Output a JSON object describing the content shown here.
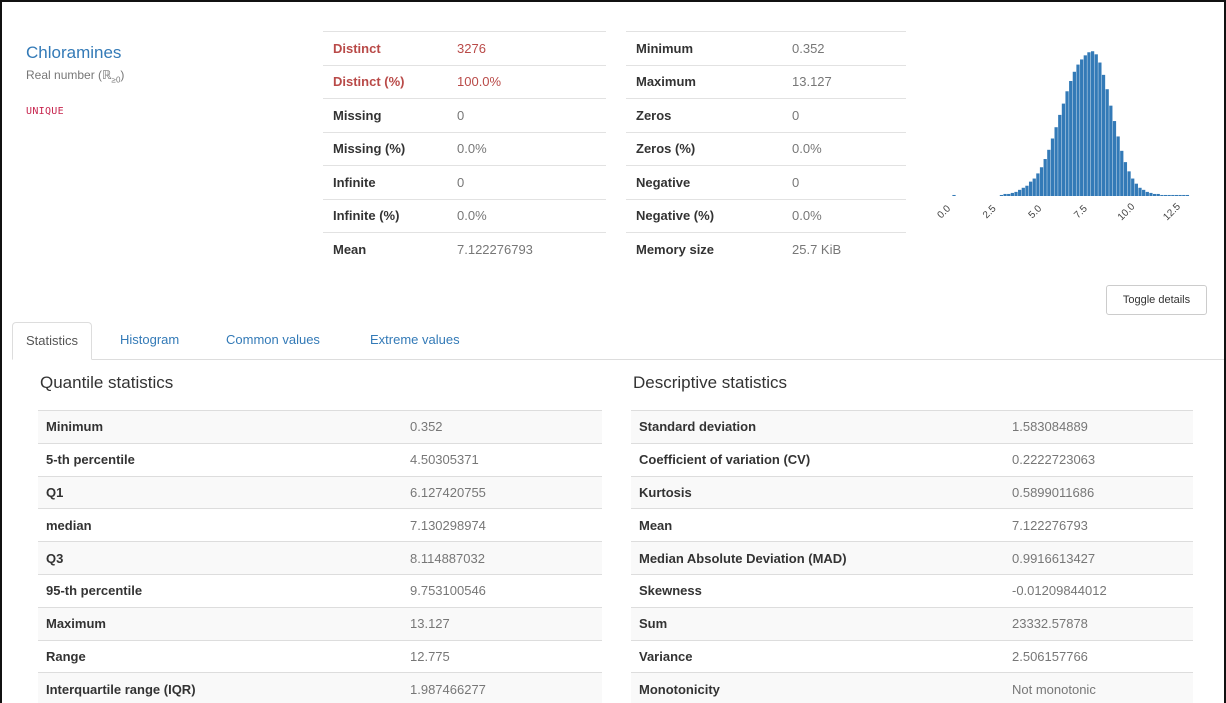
{
  "variable": {
    "name": "Chloramines",
    "type_prefix": "Real number (ℝ",
    "type_sub": "≥0",
    "type_suffix": ")",
    "badge": "UNIQUE"
  },
  "overview_left": [
    {
      "label": "Distinct",
      "value": "3276",
      "alert": true
    },
    {
      "label": "Distinct (%)",
      "value": "100.0%",
      "alert": true
    },
    {
      "label": "Missing",
      "value": "0",
      "alert": false
    },
    {
      "label": "Missing (%)",
      "value": "0.0%",
      "alert": false
    },
    {
      "label": "Infinite",
      "value": "0",
      "alert": false
    },
    {
      "label": "Infinite (%)",
      "value": "0.0%",
      "alert": false
    },
    {
      "label": "Mean",
      "value": "7.122276793",
      "alert": false
    }
  ],
  "overview_right": [
    {
      "label": "Minimum",
      "value": "0.352"
    },
    {
      "label": "Maximum",
      "value": "13.127"
    },
    {
      "label": "Zeros",
      "value": "0"
    },
    {
      "label": "Zeros (%)",
      "value": "0.0%"
    },
    {
      "label": "Negative",
      "value": "0"
    },
    {
      "label": "Negative (%)",
      "value": "0.0%"
    },
    {
      "label": "Memory size",
      "value": "25.7 KiB"
    }
  ],
  "toggle_label": "Toggle details",
  "tabs": [
    "Statistics",
    "Histogram",
    "Common values",
    "Extreme values"
  ],
  "quantile": {
    "title": "Quantile statistics",
    "rows": [
      {
        "label": "Minimum",
        "value": "0.352"
      },
      {
        "label": "5-th percentile",
        "value": "4.50305371"
      },
      {
        "label": "Q1",
        "value": "6.127420755"
      },
      {
        "label": "median",
        "value": "7.130298974"
      },
      {
        "label": "Q3",
        "value": "8.114887032"
      },
      {
        "label": "95-th percentile",
        "value": "9.753100546"
      },
      {
        "label": "Maximum",
        "value": "13.127"
      },
      {
        "label": "Range",
        "value": "12.775"
      },
      {
        "label": "Interquartile range (IQR)",
        "value": "1.987466277"
      }
    ]
  },
  "descriptive": {
    "title": "Descriptive statistics",
    "rows": [
      {
        "label": "Standard deviation",
        "value": "1.583084889"
      },
      {
        "label": "Coefficient of variation (CV)",
        "value": "0.2222723063"
      },
      {
        "label": "Kurtosis",
        "value": "0.5899011686"
      },
      {
        "label": "Mean",
        "value": "7.122276793"
      },
      {
        "label": "Median Absolute Deviation (MAD)",
        "value": "0.9916613427"
      },
      {
        "label": "Skewness",
        "value": "-0.01209844012"
      },
      {
        "label": "Sum",
        "value": "23332.57878"
      },
      {
        "label": "Variance",
        "value": "2.506157766"
      },
      {
        "label": "Monotonicity",
        "value": "Not monotonic"
      }
    ]
  },
  "chart_data": {
    "type": "bar",
    "bar_color": "#337ab7",
    "xlim": [
      0,
      13.6
    ],
    "ylim": [
      0,
      150
    ],
    "tick_labels": [
      "0.0",
      "2.5",
      "5.0",
      "7.5",
      "10.0",
      "12.5"
    ],
    "tick_values": [
      0,
      2.5,
      5,
      7.5,
      10,
      12.5
    ],
    "bin_start": 0.35,
    "bin_width": 0.2,
    "values": [
      1,
      0,
      0,
      0,
      0,
      0,
      0,
      0,
      0,
      0,
      0,
      0,
      0,
      1,
      2,
      2,
      3,
      4,
      6,
      8,
      10,
      14,
      17,
      22,
      28,
      36,
      45,
      56,
      67,
      79,
      90,
      102,
      112,
      121,
      128,
      133,
      137,
      140,
      141,
      138,
      130,
      118,
      104,
      88,
      73,
      58,
      44,
      33,
      24,
      17,
      12,
      8,
      6,
      4,
      3,
      2,
      2,
      1,
      1,
      1,
      1,
      1,
      1,
      1,
      1
    ]
  },
  "colors": {
    "link": "#337ab7",
    "alert": "#b94a48",
    "badge": "#c7254e",
    "muted": "#777777"
  }
}
